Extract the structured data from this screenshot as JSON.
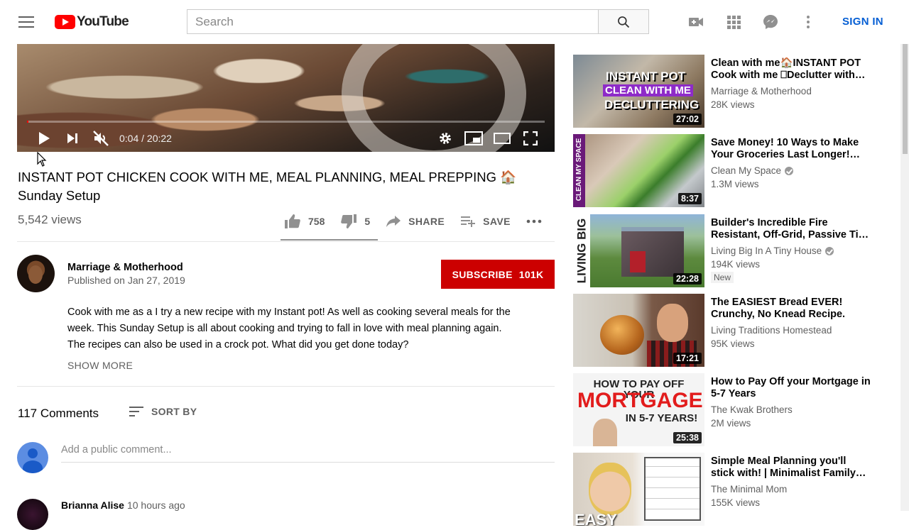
{
  "header": {
    "logo_text": "YouTube",
    "search_placeholder": "Search",
    "sign_in": "SIGN IN",
    "icons": [
      "menu-icon",
      "search-icon",
      "create-video-icon",
      "apps-icon",
      "messages-icon",
      "more-vert-icon"
    ]
  },
  "player": {
    "time": "0:04 / 20:22",
    "progress": 0.003
  },
  "video": {
    "title": "INSTANT POT CHICKEN COOK WITH ME, MEAL PLANNING, MEAL PREPPING 🏠 Sunday Setup",
    "views": "5,542 views",
    "likes": "758",
    "dislikes": "5",
    "share": "SHARE",
    "save": "SAVE"
  },
  "channel": {
    "name": "Marriage & Motherhood",
    "published": "Published on Jan 27, 2019",
    "subscribe": "SUBSCRIBE",
    "subscribers": "101K"
  },
  "description": {
    "line1": "Cook with me as a I try a new recipe with my Instant pot!  As well as cooking several meals for the",
    "line2": "week.  This Sunday Setup is all about cooking and trying to fall in love with meal planning again.",
    "line3": "The recipes can also be used in a crock pot.  What did you get done today?",
    "show_more": "SHOW MORE"
  },
  "comments": {
    "count": "117 Comments",
    "sort_by": "SORT BY",
    "placeholder": "Add a public comment...",
    "first_author": "Brianna Alise",
    "first_time": "10 hours ago"
  },
  "recommendations": [
    {
      "title": "Clean with me🏠INSTANT POT Cook with me ⎕Declutter with…",
      "channel": "Marriage & Motherhood",
      "views": "28K views",
      "duration": "27:02",
      "verified": false,
      "thumb_text": [
        "INSTANT POT",
        "CLEAN WITH ME",
        "DECLUTTERING"
      ]
    },
    {
      "title": "Save Money! 10 Ways to Make Your Groceries Last Longer!…",
      "channel": "Clean My Space",
      "views": "1.3M views",
      "duration": "8:37",
      "verified": true,
      "thumb_text": [
        "CLEAN MY SPACE"
      ]
    },
    {
      "title": "Builder's Incredible Fire Resistant, Off-Grid, Passive Ti…",
      "channel": "Living Big In A Tiny House",
      "views": "194K views",
      "duration": "22:28",
      "verified": true,
      "badge": "New",
      "thumb_text": [
        "LIVING BIG"
      ]
    },
    {
      "title": "The EASIEST Bread EVER! Crunchy, No Knead Recipe.",
      "channel": "Living Traditions Homestead",
      "views": "95K views",
      "duration": "17:21",
      "verified": false
    },
    {
      "title": "How to Pay Off your Mortgage in 5-7 Years",
      "channel": "The Kwak Brothers",
      "views": "2M views",
      "duration": "25:38",
      "verified": false,
      "thumb_text": [
        "HOW TO PAY OFF YOUR",
        "MORTGAGE",
        "IN 5-7 YEARS!"
      ]
    },
    {
      "title": "Simple Meal Planning you'll stick with! | Minimalist Family…",
      "channel": "The Minimal Mom",
      "views": "155K views",
      "duration": "",
      "verified": false,
      "thumb_text": [
        "EASY"
      ]
    }
  ]
}
